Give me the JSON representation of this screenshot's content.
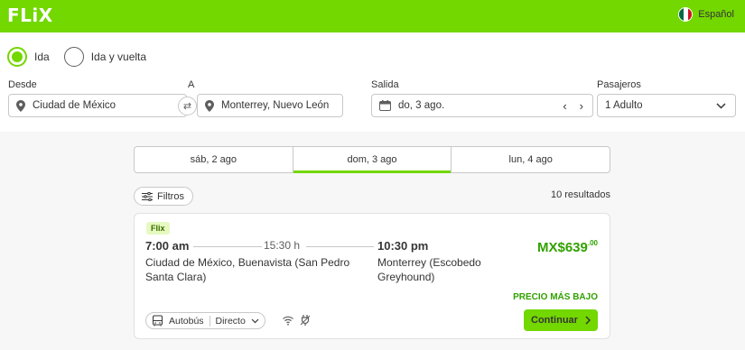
{
  "header": {
    "logo": "FLiX",
    "language": "Español",
    "brand_color": "#73d700"
  },
  "trip_type": {
    "options": [
      {
        "label": "Ida",
        "selected": true
      },
      {
        "label": "Ida y vuelta",
        "selected": false
      }
    ]
  },
  "search": {
    "from_label": "Desde",
    "from_value": "Ciudad de México",
    "to_label": "A",
    "to_value": "Monterrey, Nuevo León",
    "date_label": "Salida",
    "date_value": "do, 3 ago.",
    "passengers_label": "Pasajeros",
    "passengers_value": "1 Adulto"
  },
  "date_tabs": [
    {
      "label": "sáb, 2 ago",
      "active": false
    },
    {
      "label": "dom, 3 ago",
      "active": true
    },
    {
      "label": "lun, 4 ago",
      "active": false
    }
  ],
  "toolbar": {
    "filters_label": "Filtros",
    "results_count": "10 resultados"
  },
  "result": {
    "brand": "Flix",
    "departure_time": "7:00 am",
    "duration": "15:30 h",
    "arrival_time": "10:30 pm",
    "departure_station": "Ciudad de México, Buenavista (San Pedro Santa Clara)",
    "arrival_station": "Monterrey (Escobedo Greyhound)",
    "price_main": "MX$639",
    "price_cents": ".00",
    "lowest_price_label": "PRECIO MÁS BAJO",
    "vehicle_label": "Autobús",
    "route_type": "Directo",
    "amenities": [
      "wifi-icon",
      "power-outlet-icon"
    ],
    "cta_label": "Continuar"
  }
}
